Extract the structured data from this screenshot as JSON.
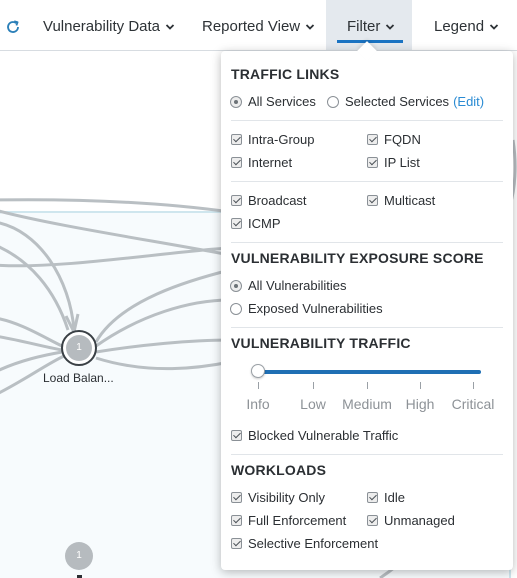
{
  "toolbar": {
    "refresh_icon": "refresh-icon",
    "menus": [
      {
        "label": "Vulnerability Data",
        "icon": "chevron-down-icon"
      },
      {
        "label": "Reported View",
        "icon": "chevron-down-icon"
      },
      {
        "label": "Filter",
        "icon": "chevron-down-icon",
        "active": true
      },
      {
        "label": "Legend",
        "icon": "chevron-down-icon"
      }
    ],
    "active_color": "#1a73c2"
  },
  "map": {
    "nodes": [
      {
        "count": "1",
        "label": "Load Balan..."
      },
      {
        "count": "1",
        "label": ""
      }
    ],
    "link_color": "#b9bfc3",
    "group_color": "#f7fbfd"
  },
  "filter_panel": {
    "traffic_links": {
      "title": "TRAFFIC LINKS",
      "services": {
        "all_label": "All Services",
        "selected_label": "Selected Services",
        "edit_label": "(Edit)",
        "selected": "All Services"
      },
      "checkboxes": [
        {
          "label": "Intra-Group",
          "checked": true
        },
        {
          "label": "FQDN",
          "checked": true
        },
        {
          "label": "Internet",
          "checked": true
        },
        {
          "label": "IP List",
          "checked": true
        },
        {
          "label": "Broadcast",
          "checked": true
        },
        {
          "label": "Multicast",
          "checked": true
        },
        {
          "label": "ICMP",
          "checked": true
        }
      ]
    },
    "exposure_score": {
      "title": "VULNERABILITY EXPOSURE SCORE",
      "options": [
        "All Vulnerabilities",
        "Exposed Vulnerabilities"
      ],
      "selected": "All Vulnerabilities"
    },
    "vulnerability_traffic": {
      "title": "VULNERABILITY TRAFFIC",
      "levels": [
        "Info",
        "Low",
        "Medium",
        "High",
        "Critical"
      ],
      "slider_value": "Info",
      "blocked_label": "Blocked Vulnerable Traffic",
      "blocked_checked": true
    },
    "workloads": {
      "title": "WORKLOADS",
      "checkboxes": [
        {
          "label": "Visibility Only",
          "checked": true
        },
        {
          "label": "Idle",
          "checked": true
        },
        {
          "label": "Full Enforcement",
          "checked": true
        },
        {
          "label": "Unmanaged",
          "checked": true
        },
        {
          "label": "Selective Enforcement",
          "checked": true
        }
      ]
    }
  }
}
